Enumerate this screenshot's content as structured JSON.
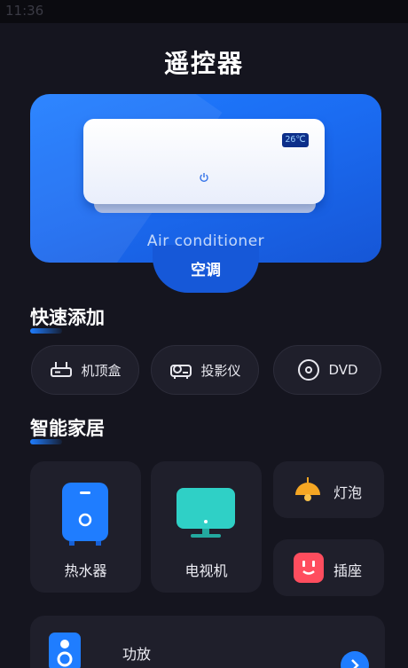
{
  "status_bar": {
    "time": "11:36"
  },
  "page": {
    "title": "遥控器"
  },
  "hero": {
    "device_display": "26℃",
    "subtitle_en": "Air conditioner",
    "label_cn": "空调"
  },
  "quick_add": {
    "title": "快速添加",
    "items": [
      {
        "label": "机顶盒",
        "icon": "set-top-box-icon"
      },
      {
        "label": "投影仪",
        "icon": "projector-icon"
      },
      {
        "label": "DVD",
        "icon": "disc-icon"
      }
    ]
  },
  "smart_home": {
    "title": "智能家居",
    "items": [
      {
        "label": "热水器",
        "icon": "water-heater-icon"
      },
      {
        "label": "电视机",
        "icon": "tv-icon"
      },
      {
        "label": "灯泡",
        "icon": "lamp-icon"
      },
      {
        "label": "插座",
        "icon": "socket-icon"
      },
      {
        "label": "功放",
        "icon": "speaker-icon"
      }
    ]
  },
  "colors": {
    "background": "#15151f",
    "card": "#1f1f2b",
    "accent_blue": "#1f7dff",
    "lamp_orange": "#f5a623",
    "socket_red": "#ff4d5e",
    "tv_teal": "#2fd0c6"
  }
}
